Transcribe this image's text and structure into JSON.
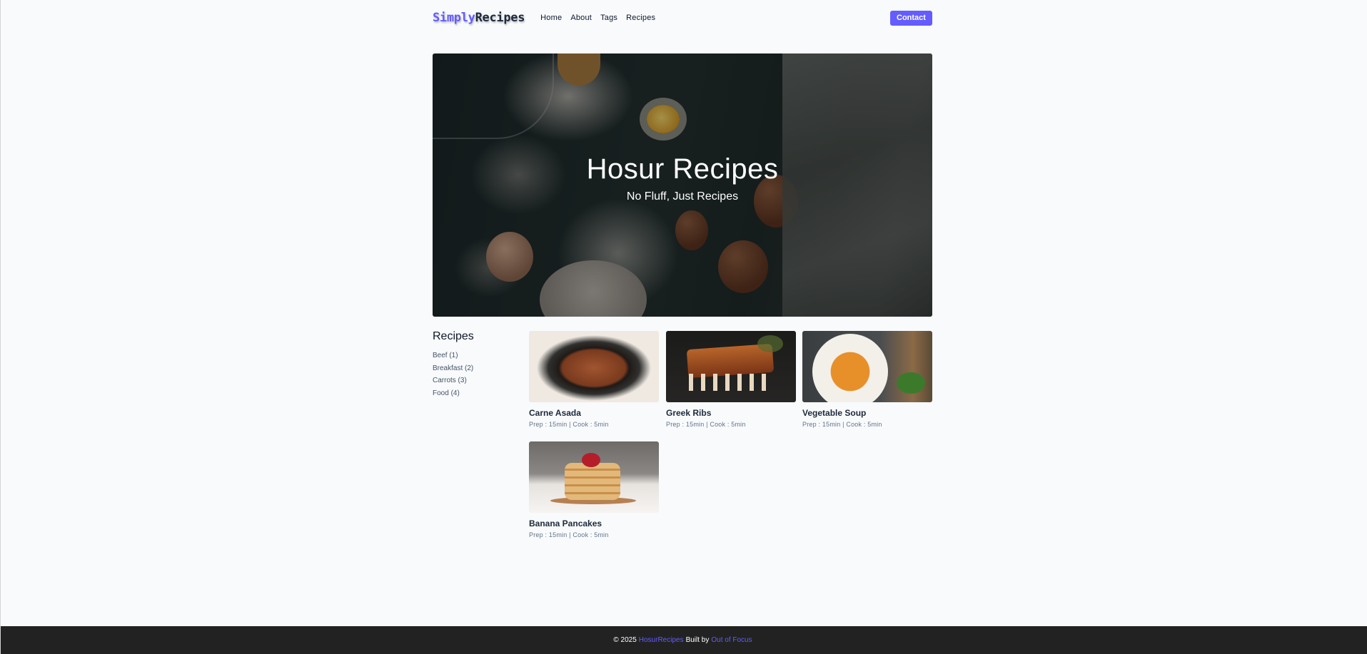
{
  "nav": {
    "logo_part1": "Simply",
    "logo_part2": "Recipes",
    "links": [
      "Home",
      "About",
      "Tags",
      "Recipes"
    ],
    "contact_label": "Contact"
  },
  "hero": {
    "title": "Hosur Recipes",
    "subtitle": "No Fluff, Just Recipes"
  },
  "sidebar": {
    "heading": "Recipes",
    "tags": [
      "Beef (1)",
      "Breakfast (2)",
      "Carrots (3)",
      "Food (4)"
    ]
  },
  "recipes": [
    {
      "title": "Carne Asada",
      "meta": "Prep : 15min | Cook : 5min"
    },
    {
      "title": "Greek Ribs",
      "meta": "Prep : 15min | Cook : 5min"
    },
    {
      "title": "Vegetable Soup",
      "meta": "Prep : 15min | Cook : 5min"
    },
    {
      "title": "Banana Pancakes",
      "meta": "Prep : 15min | Cook : 5min"
    }
  ],
  "footer": {
    "copyright": "© 2025",
    "site_name": "HosurRecipes",
    "built_by_text": "Built by",
    "author": "Out of Focus"
  },
  "colors": {
    "accent": "#645cff",
    "footer_bg": "#222222",
    "page_bg": "#f8fafc"
  }
}
